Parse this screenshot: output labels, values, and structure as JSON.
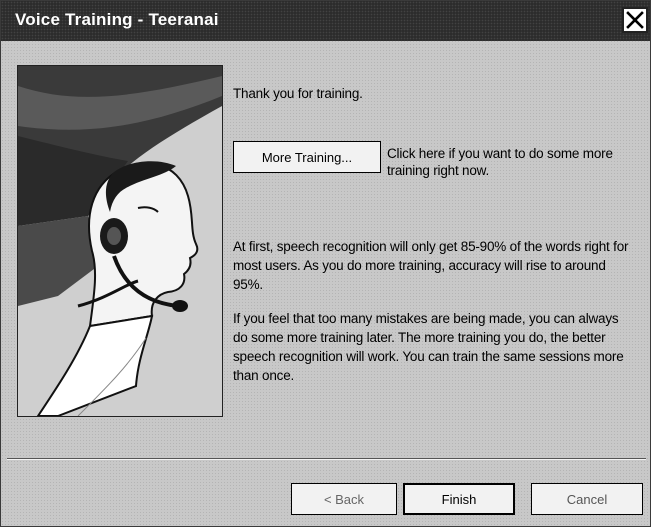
{
  "window": {
    "title": "Voice Training - Teeranai"
  },
  "content": {
    "thanks": "Thank you for training.",
    "more_training_button": "More Training...",
    "more_training_hint": "Click here if you want to do some more training right now.",
    "paragraph1": "At first, speech recognition will only get 85-90% of the words right for most users. As you do more training, accuracy will rise to around 95%.",
    "paragraph2": "If you feel that too many mistakes are being made, you can always do some more training later. The more training you do, the better speech recognition will work. You can train the same sessions more than once."
  },
  "footer": {
    "back_label": "< Back",
    "finish_label": "Finish",
    "cancel_label": "Cancel"
  },
  "icons": {
    "close": "close-icon",
    "illustration": "headset-user-illustration"
  }
}
